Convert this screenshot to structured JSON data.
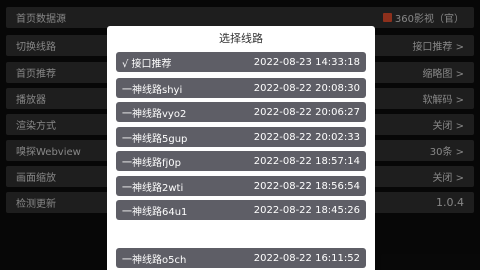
{
  "settings": {
    "rows": [
      {
        "label": "首页数据源",
        "value": "360影视（官）",
        "icon": "brand-icon"
      },
      {
        "label": "切换线路",
        "value": "接口推荐 >"
      },
      {
        "label": "首页推荐",
        "value": "缩略图 >"
      },
      {
        "label": "播放器",
        "value": "软解码 >"
      },
      {
        "label": "渲染方式",
        "value": "关闭 >"
      },
      {
        "label": "嗅探Webview",
        "value": "30条 >"
      },
      {
        "label": "画面缩放",
        "value": "关闭 >"
      },
      {
        "label": "检测更新",
        "value": "1.0.4"
      }
    ]
  },
  "dialog": {
    "title": "选择线路",
    "routes": [
      {
        "name": "√ 接口推荐",
        "time": "2022-08-23 14:33:18"
      },
      {
        "name": "一神线路shyi",
        "time": "2022-08-22 20:08:30"
      },
      {
        "name": "一神线路vyo2",
        "time": "2022-08-22 20:06:27"
      },
      {
        "name": "一神线路5gup",
        "time": "2022-08-22 20:02:33"
      },
      {
        "name": "一神线路fj0p",
        "time": "2022-08-22 18:57:14"
      },
      {
        "name": "一神线路2wti",
        "time": "2022-08-22 18:56:54"
      },
      {
        "name": "一神线路64u1",
        "time": "2022-08-22 18:45:26"
      },
      {
        "name": "一神线路o5ch",
        "time": "2022-08-22 16:11:52"
      }
    ]
  }
}
